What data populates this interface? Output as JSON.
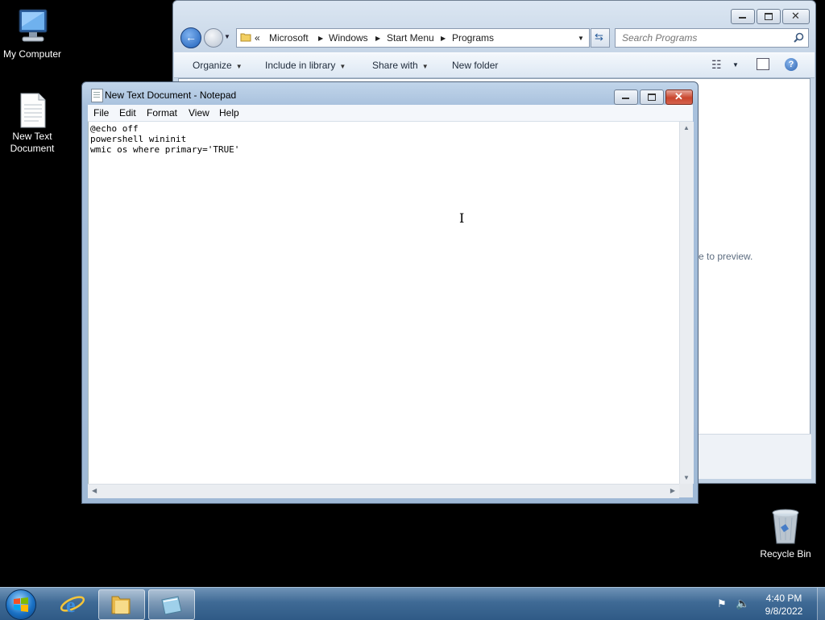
{
  "desktop": {
    "icons": [
      {
        "label": "My Computer"
      },
      {
        "label": "New Text Document"
      },
      {
        "label": "Recycle Bin"
      }
    ]
  },
  "explorer": {
    "breadcrumb": [
      "«",
      "Microsoft",
      "Windows",
      "Start Menu",
      "Programs"
    ],
    "search_placeholder": "Search Programs",
    "toolbar": {
      "organize": "Organize",
      "include_in_library": "Include in library",
      "share_with": "Share with",
      "new_folder": "New folder"
    },
    "preview_hint": "e to preview."
  },
  "notepad": {
    "title": "New Text Document - Notepad",
    "menu": [
      "File",
      "Edit",
      "Format",
      "View",
      "Help"
    ],
    "content": "@echo off\npowershell wininit\nwmic os where primary='TRUE'"
  },
  "taskbar": {
    "time": "4:40 PM",
    "date": "9/8/2022"
  },
  "colors": {
    "desktop_bg": "#000000",
    "taskbar": "#3f6a95",
    "close_button": "#c9452d"
  }
}
